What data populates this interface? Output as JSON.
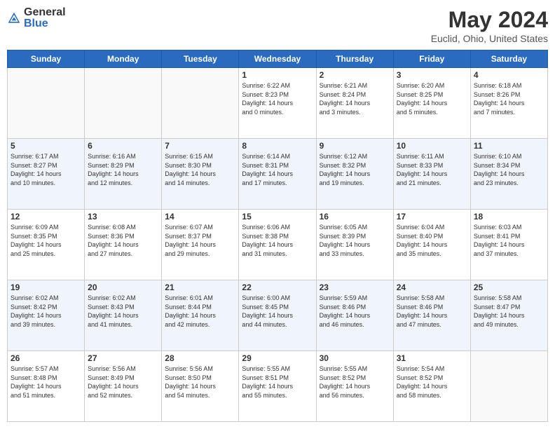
{
  "logo": {
    "general": "General",
    "blue": "Blue"
  },
  "header": {
    "month": "May 2024",
    "location": "Euclid, Ohio, United States"
  },
  "weekdays": [
    "Sunday",
    "Monday",
    "Tuesday",
    "Wednesday",
    "Thursday",
    "Friday",
    "Saturday"
  ],
  "weeks": [
    [
      {
        "day": "",
        "info": ""
      },
      {
        "day": "",
        "info": ""
      },
      {
        "day": "",
        "info": ""
      },
      {
        "day": "1",
        "info": "Sunrise: 6:22 AM\nSunset: 8:23 PM\nDaylight: 14 hours\nand 0 minutes."
      },
      {
        "day": "2",
        "info": "Sunrise: 6:21 AM\nSunset: 8:24 PM\nDaylight: 14 hours\nand 3 minutes."
      },
      {
        "day": "3",
        "info": "Sunrise: 6:20 AM\nSunset: 8:25 PM\nDaylight: 14 hours\nand 5 minutes."
      },
      {
        "day": "4",
        "info": "Sunrise: 6:18 AM\nSunset: 8:26 PM\nDaylight: 14 hours\nand 7 minutes."
      }
    ],
    [
      {
        "day": "5",
        "info": "Sunrise: 6:17 AM\nSunset: 8:27 PM\nDaylight: 14 hours\nand 10 minutes."
      },
      {
        "day": "6",
        "info": "Sunrise: 6:16 AM\nSunset: 8:29 PM\nDaylight: 14 hours\nand 12 minutes."
      },
      {
        "day": "7",
        "info": "Sunrise: 6:15 AM\nSunset: 8:30 PM\nDaylight: 14 hours\nand 14 minutes."
      },
      {
        "day": "8",
        "info": "Sunrise: 6:14 AM\nSunset: 8:31 PM\nDaylight: 14 hours\nand 17 minutes."
      },
      {
        "day": "9",
        "info": "Sunrise: 6:12 AM\nSunset: 8:32 PM\nDaylight: 14 hours\nand 19 minutes."
      },
      {
        "day": "10",
        "info": "Sunrise: 6:11 AM\nSunset: 8:33 PM\nDaylight: 14 hours\nand 21 minutes."
      },
      {
        "day": "11",
        "info": "Sunrise: 6:10 AM\nSunset: 8:34 PM\nDaylight: 14 hours\nand 23 minutes."
      }
    ],
    [
      {
        "day": "12",
        "info": "Sunrise: 6:09 AM\nSunset: 8:35 PM\nDaylight: 14 hours\nand 25 minutes."
      },
      {
        "day": "13",
        "info": "Sunrise: 6:08 AM\nSunset: 8:36 PM\nDaylight: 14 hours\nand 27 minutes."
      },
      {
        "day": "14",
        "info": "Sunrise: 6:07 AM\nSunset: 8:37 PM\nDaylight: 14 hours\nand 29 minutes."
      },
      {
        "day": "15",
        "info": "Sunrise: 6:06 AM\nSunset: 8:38 PM\nDaylight: 14 hours\nand 31 minutes."
      },
      {
        "day": "16",
        "info": "Sunrise: 6:05 AM\nSunset: 8:39 PM\nDaylight: 14 hours\nand 33 minutes."
      },
      {
        "day": "17",
        "info": "Sunrise: 6:04 AM\nSunset: 8:40 PM\nDaylight: 14 hours\nand 35 minutes."
      },
      {
        "day": "18",
        "info": "Sunrise: 6:03 AM\nSunset: 8:41 PM\nDaylight: 14 hours\nand 37 minutes."
      }
    ],
    [
      {
        "day": "19",
        "info": "Sunrise: 6:02 AM\nSunset: 8:42 PM\nDaylight: 14 hours\nand 39 minutes."
      },
      {
        "day": "20",
        "info": "Sunrise: 6:02 AM\nSunset: 8:43 PM\nDaylight: 14 hours\nand 41 minutes."
      },
      {
        "day": "21",
        "info": "Sunrise: 6:01 AM\nSunset: 8:44 PM\nDaylight: 14 hours\nand 42 minutes."
      },
      {
        "day": "22",
        "info": "Sunrise: 6:00 AM\nSunset: 8:45 PM\nDaylight: 14 hours\nand 44 minutes."
      },
      {
        "day": "23",
        "info": "Sunrise: 5:59 AM\nSunset: 8:46 PM\nDaylight: 14 hours\nand 46 minutes."
      },
      {
        "day": "24",
        "info": "Sunrise: 5:58 AM\nSunset: 8:46 PM\nDaylight: 14 hours\nand 47 minutes."
      },
      {
        "day": "25",
        "info": "Sunrise: 5:58 AM\nSunset: 8:47 PM\nDaylight: 14 hours\nand 49 minutes."
      }
    ],
    [
      {
        "day": "26",
        "info": "Sunrise: 5:57 AM\nSunset: 8:48 PM\nDaylight: 14 hours\nand 51 minutes."
      },
      {
        "day": "27",
        "info": "Sunrise: 5:56 AM\nSunset: 8:49 PM\nDaylight: 14 hours\nand 52 minutes."
      },
      {
        "day": "28",
        "info": "Sunrise: 5:56 AM\nSunset: 8:50 PM\nDaylight: 14 hours\nand 54 minutes."
      },
      {
        "day": "29",
        "info": "Sunrise: 5:55 AM\nSunset: 8:51 PM\nDaylight: 14 hours\nand 55 minutes."
      },
      {
        "day": "30",
        "info": "Sunrise: 5:55 AM\nSunset: 8:52 PM\nDaylight: 14 hours\nand 56 minutes."
      },
      {
        "day": "31",
        "info": "Sunrise: 5:54 AM\nSunset: 8:52 PM\nDaylight: 14 hours\nand 58 minutes."
      },
      {
        "day": "",
        "info": ""
      }
    ]
  ]
}
